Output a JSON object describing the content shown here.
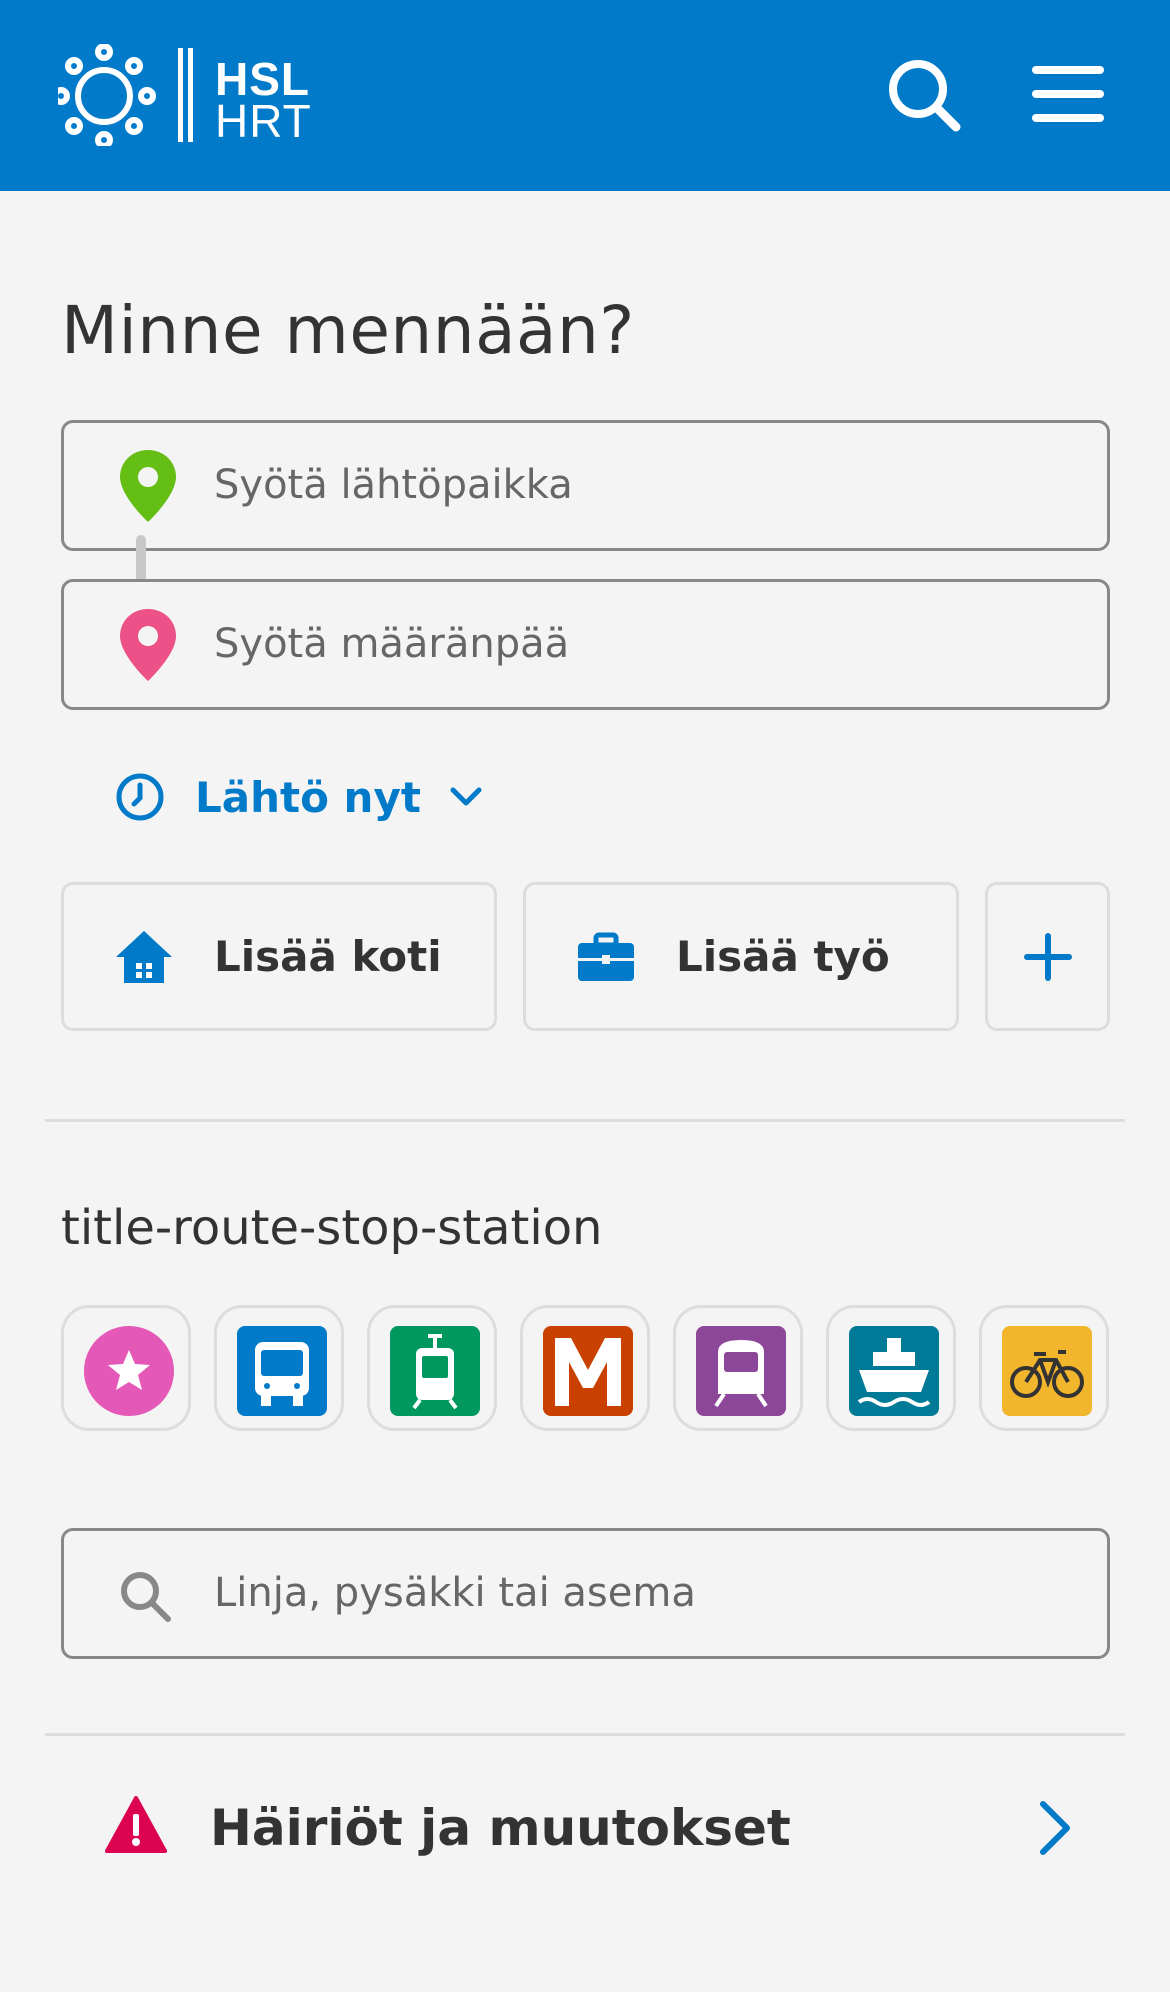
{
  "header": {
    "logo_line1": "HSL",
    "logo_line2": "HRT",
    "brand_color": "#007ac9",
    "icons": [
      "search-icon",
      "menu-icon"
    ]
  },
  "main": {
    "title": "Minne mennään?",
    "origin_placeholder": "Syötä lähtöpaikka",
    "destination_placeholder": "Syötä määränpää",
    "origin_pin_color": "#64be14",
    "destination_pin_color": "#ec5188",
    "time_selector": "Lähtö nyt"
  },
  "favourites": {
    "home": "Lisää koti",
    "work": "Lisää työ",
    "add_icon": "plus-icon"
  },
  "routes": {
    "title": "title-route-stop-station",
    "search_placeholder": "Linja, pysäkki tai asema",
    "modes": [
      {
        "name": "favourites",
        "color": "#e458b7"
      },
      {
        "name": "bus",
        "color": "#007ac9"
      },
      {
        "name": "tram",
        "color": "#00985f"
      },
      {
        "name": "metro",
        "color": "#ca4000"
      },
      {
        "name": "train",
        "color": "#8c4799"
      },
      {
        "name": "ferry",
        "color": "#007a97"
      },
      {
        "name": "citybike",
        "color": "#f2b62d"
      }
    ]
  },
  "disruptions": {
    "label": "Häiriöt ja muutokset",
    "warning_color": "#dc0451"
  }
}
